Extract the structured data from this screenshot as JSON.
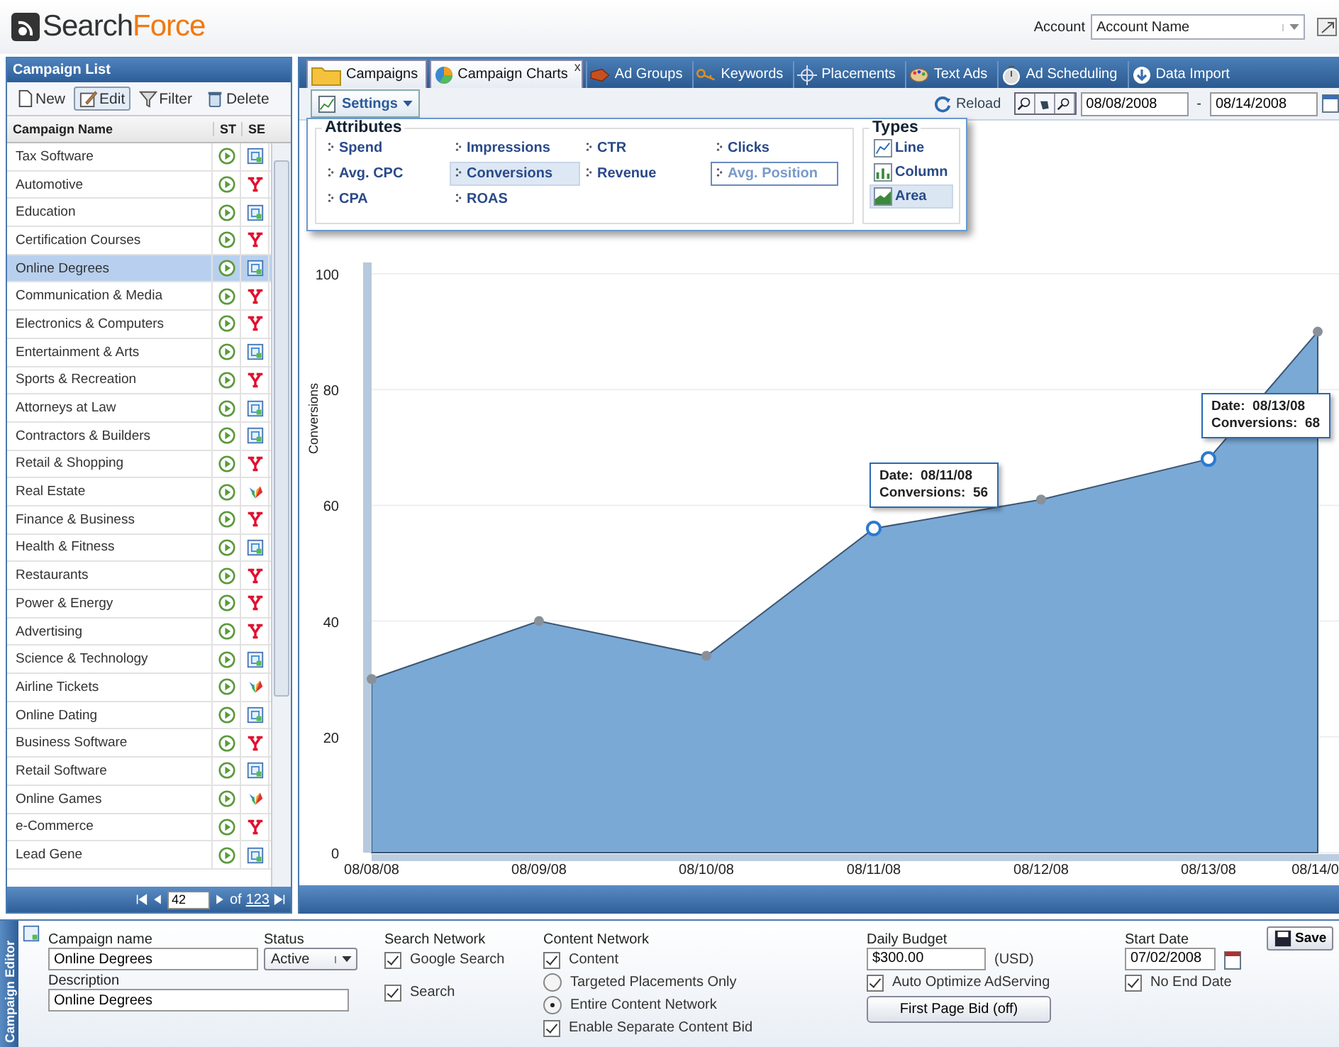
{
  "header": {
    "logo_dark": "Search",
    "logo_accent": "Force",
    "account_label": "Account",
    "account_value": "Account Name"
  },
  "campaign_list": {
    "title": "Campaign List",
    "toolbar": [
      {
        "label": "New",
        "selected": false
      },
      {
        "label": "Edit",
        "selected": true
      },
      {
        "label": "Filter",
        "selected": false
      },
      {
        "label": "Delete",
        "selected": false
      }
    ],
    "columns": [
      "Campaign Name",
      "ST",
      "SE"
    ],
    "rows": [
      {
        "name": "Tax Software",
        "kind": "google",
        "selected": false
      },
      {
        "name": "Automotive",
        "kind": "yahoo",
        "selected": false
      },
      {
        "name": "Education",
        "kind": "google",
        "selected": false
      },
      {
        "name": "Certification Courses",
        "kind": "yahoo",
        "selected": false
      },
      {
        "name": "Online Degrees",
        "kind": "google",
        "selected": true
      },
      {
        "name": "Communication & Media",
        "kind": "yahoo",
        "selected": false
      },
      {
        "name": "Electronics & Computers",
        "kind": "yahoo",
        "selected": false
      },
      {
        "name": "Entertainment & Arts",
        "kind": "google",
        "selected": false
      },
      {
        "name": "Sports & Recreation",
        "kind": "yahoo",
        "selected": false
      },
      {
        "name": "Attorneys at Law",
        "kind": "google",
        "selected": false
      },
      {
        "name": "Contractors & Builders",
        "kind": "google",
        "selected": false
      },
      {
        "name": "Retail & Shopping",
        "kind": "yahoo",
        "selected": false
      },
      {
        "name": "Real Estate",
        "kind": "msn",
        "selected": false
      },
      {
        "name": "Finance & Business",
        "kind": "yahoo",
        "selected": false
      },
      {
        "name": "Health & Fitness",
        "kind": "google",
        "selected": false
      },
      {
        "name": "Restaurants",
        "kind": "yahoo",
        "selected": false
      },
      {
        "name": "Power & Energy",
        "kind": "yahoo",
        "selected": false
      },
      {
        "name": "Advertising",
        "kind": "yahoo",
        "selected": false
      },
      {
        "name": "Science & Technology",
        "kind": "google",
        "selected": false
      },
      {
        "name": "Airline Tickets",
        "kind": "msn",
        "selected": false
      },
      {
        "name": "Online Dating",
        "kind": "google",
        "selected": false
      },
      {
        "name": "Business Software",
        "kind": "yahoo",
        "selected": false
      },
      {
        "name": "Retail Software",
        "kind": "google",
        "selected": false
      },
      {
        "name": "Online Games",
        "kind": "msn",
        "selected": false
      },
      {
        "name": "e-Commerce",
        "kind": "yahoo",
        "selected": false
      },
      {
        "name": "Lead Gene",
        "kind": "google",
        "selected": false
      }
    ],
    "pager": {
      "page": "42",
      "of": "of",
      "total": "123"
    }
  },
  "tabs": [
    {
      "label": "Campaigns",
      "selected": true
    },
    {
      "label": "Campaign Charts",
      "selected": true,
      "close": "x"
    },
    {
      "label": "Ad Groups",
      "selected": false
    },
    {
      "label": "Keywords",
      "selected": false
    },
    {
      "label": "Placements",
      "selected": false
    },
    {
      "label": "Text Ads",
      "selected": false
    },
    {
      "label": "Ad Scheduling",
      "selected": false
    },
    {
      "label": "Data Import",
      "selected": false
    }
  ],
  "chart_toolbar": {
    "settings": "Settings",
    "reload": "Reload",
    "start_date": "08/08/2008",
    "separator": "-",
    "end_date": "08/14/2008"
  },
  "settings_popup": {
    "attributes_title": "Attributes",
    "attributes": [
      {
        "label": "Spend",
        "selected": false,
        "focused": false
      },
      {
        "label": "Impressions",
        "selected": false,
        "focused": false
      },
      {
        "label": "CTR",
        "selected": false,
        "focused": false
      },
      {
        "label": "Clicks",
        "selected": false,
        "focused": false
      },
      {
        "label": "Avg. CPC",
        "selected": false,
        "focused": false
      },
      {
        "label": "Conversions",
        "selected": true,
        "focused": false
      },
      {
        "label": "Revenue",
        "selected": false,
        "focused": false
      },
      {
        "label": "Avg. Position",
        "selected": false,
        "focused": true
      },
      {
        "label": "CPA",
        "selected": false,
        "focused": false
      },
      {
        "label": "ROAS",
        "selected": false,
        "focused": false
      }
    ],
    "types_title": "Types",
    "types": [
      {
        "label": "Line",
        "selected": false
      },
      {
        "label": "Column",
        "selected": false
      },
      {
        "label": "Area",
        "selected": true
      }
    ]
  },
  "chart": {
    "chart_data": {
      "type": "area",
      "ylabel": "Conversions",
      "categories": [
        "08/08/08",
        "08/09/08",
        "08/10/08",
        "08/11/08",
        "08/12/08",
        "08/13/08",
        "08/14/0"
      ],
      "series": [
        {
          "color": "#7aa9d6",
          "values": [
            30,
            40,
            34,
            56,
            61,
            68,
            90
          ]
        }
      ],
      "ylim": [
        0,
        100
      ],
      "yticks": [
        0,
        20,
        40,
        60,
        80,
        100
      ],
      "grid": true,
      "annotations": [
        {
          "x": "08/11/08",
          "y": 56,
          "text": "Date:  08/11/08\nConversions:  56"
        },
        {
          "x": "08/13/08",
          "y": 68,
          "text": "Date:  08/13/08\nConversions:  68"
        }
      ]
    }
  },
  "editor": {
    "title": "Campaign Editor",
    "name": {
      "label": "Campaign name",
      "value": "Online Degrees"
    },
    "status": {
      "label": "Status",
      "value": "Active"
    },
    "description": {
      "label": "Description",
      "value": "Online Degrees"
    },
    "search_network": {
      "label": "Search Network",
      "options": [
        {
          "label": "Google Search",
          "checked": true
        },
        {
          "label": "Search",
          "checked": true
        }
      ]
    },
    "content_network": {
      "label": "Content Network",
      "options": [
        {
          "kind": "checkbox",
          "label": "Content",
          "checked": true
        },
        {
          "kind": "radio",
          "label": "Targeted Placements Only",
          "checked": false
        },
        {
          "kind": "radio",
          "label": "Entire Content Network",
          "checked": true
        },
        {
          "kind": "checkbox",
          "label": "Enable Separate Content Bid",
          "checked": true
        }
      ]
    },
    "budget": {
      "label": "Daily Budget",
      "value": "$300.00",
      "currency": "(USD)",
      "auto_optimize": {
        "label": "Auto Optimize AdServing",
        "checked": true
      },
      "button": "First Page Bid (off)"
    },
    "start": {
      "label": "Start Date",
      "value": "07/02/2008",
      "no_end": {
        "label": "No End Date",
        "checked": true
      }
    },
    "save": "Save"
  }
}
